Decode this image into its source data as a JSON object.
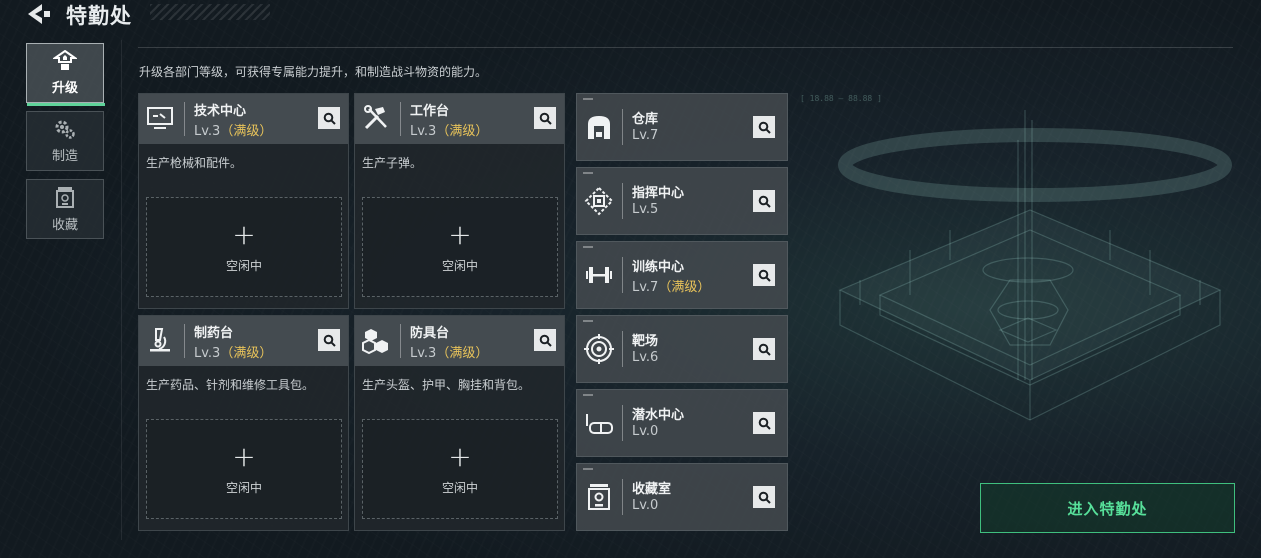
{
  "header": {
    "title": "特勤处"
  },
  "sidebar": {
    "tabs": [
      {
        "label": "升级",
        "icon": "upgrade-icon",
        "active": true
      },
      {
        "label": "制造",
        "icon": "gears-icon",
        "active": false
      },
      {
        "label": "收藏",
        "icon": "collection-icon",
        "active": false
      }
    ]
  },
  "description": "升级各部门等级，可获得专属能力提升，和制造战斗物资的能力。",
  "workbenches": [
    {
      "name": "技术中心",
      "level": "Lv.3",
      "maxed": "（满级）",
      "desc": "生产枪械和配件。",
      "icon": "monitor-icon",
      "slot": {
        "plus": "+",
        "label": "空闲中"
      }
    },
    {
      "name": "工作台",
      "level": "Lv.3",
      "maxed": "（满级）",
      "desc": "生产子弹。",
      "icon": "tools-icon",
      "slot": {
        "plus": "+",
        "label": "空闲中"
      }
    },
    {
      "name": "制药台",
      "level": "Lv.3",
      "maxed": "（满级）",
      "desc": "生产药品、针剂和维修工具包。",
      "icon": "microscope-icon",
      "slot": {
        "plus": "+",
        "label": "空闲中"
      }
    },
    {
      "name": "防具台",
      "level": "Lv.3",
      "maxed": "（满级）",
      "desc": "生产头盔、护甲、胸挂和背包。",
      "icon": "cubes-icon",
      "slot": {
        "plus": "+",
        "label": "空闲中"
      }
    }
  ],
  "facilities": [
    {
      "name": "仓库",
      "level": "Lv.7",
      "maxed": "",
      "icon": "warehouse-icon"
    },
    {
      "name": "指挥中心",
      "level": "Lv.5",
      "maxed": "",
      "icon": "command-chip-icon"
    },
    {
      "name": "训练中心",
      "level": "Lv.7",
      "maxed": "（满级）",
      "icon": "dumbbell-icon"
    },
    {
      "name": "靶场",
      "level": "Lv.6",
      "maxed": "",
      "icon": "target-icon"
    },
    {
      "name": "潜水中心",
      "level": "Lv.0",
      "maxed": "",
      "icon": "diving-mask-icon"
    },
    {
      "name": "收藏室",
      "level": "Lv.0",
      "maxed": "",
      "icon": "collection-room-icon"
    }
  ],
  "hud": "[ 18.88 — 88.88 ]",
  "enter_button": {
    "label": "进入特勤处"
  },
  "colors": {
    "accent_green": "#57e09a",
    "maxed_gold": "#e8c35a",
    "active_bar": "#5fd39a"
  }
}
